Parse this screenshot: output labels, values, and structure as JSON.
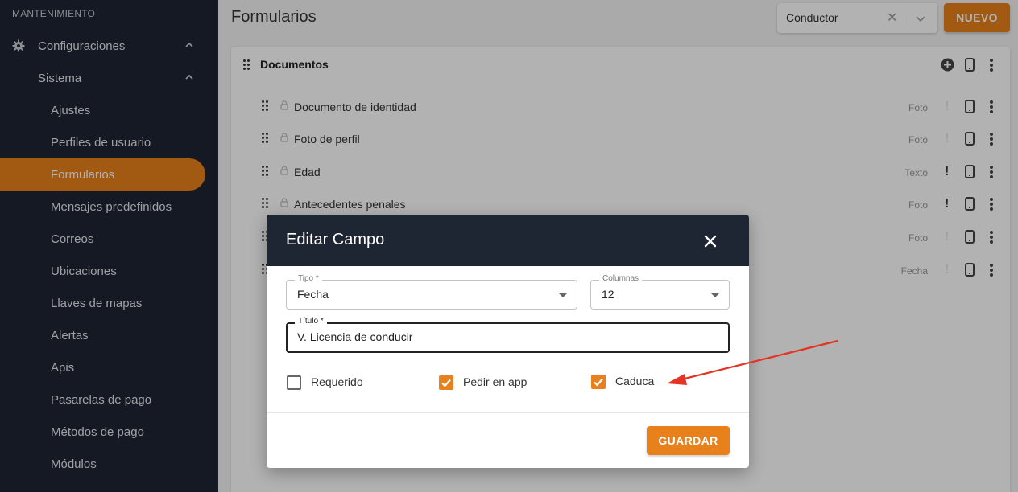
{
  "sidebar": {
    "section_title": "MANTENIMIENTO",
    "items": [
      {
        "label": "Configuraciones",
        "icon": "gear-icon"
      },
      {
        "label": "Sistema"
      },
      {
        "label": "Ajustes"
      },
      {
        "label": "Perfiles de usuario"
      },
      {
        "label": "Formularios",
        "active": true
      },
      {
        "label": "Mensajes predefinidos"
      },
      {
        "label": "Correos"
      },
      {
        "label": "Ubicaciones"
      },
      {
        "label": "Llaves de mapas"
      },
      {
        "label": "Alertas"
      },
      {
        "label": "Apis"
      },
      {
        "label": "Pasarelas de pago"
      },
      {
        "label": "Métodos de pago"
      },
      {
        "label": "Módulos"
      }
    ]
  },
  "header": {
    "title": "Formularios",
    "select_value": "Conductor",
    "new_button": "NUEVO"
  },
  "card": {
    "title": "Documentos",
    "rows": [
      {
        "label": "Documento de identidad",
        "type": "Foto",
        "required": false
      },
      {
        "label": "Foto de perfil",
        "type": "Foto",
        "required": false
      },
      {
        "label": "Edad",
        "type": "Texto",
        "required": true
      },
      {
        "label": "Antecedentes penales",
        "type": "Foto",
        "required": true
      },
      {
        "label": "",
        "type": "Foto",
        "required": false
      },
      {
        "label": "",
        "type": "Fecha",
        "required": false
      }
    ]
  },
  "modal": {
    "title": "Editar Campo",
    "tipo_label": "Tipo *",
    "tipo_value": "Fecha",
    "columnas_label": "Columnas",
    "columnas_value": "12",
    "titulo_label": "Título *",
    "titulo_value": "V. Licencia de conducir",
    "checkboxes": [
      {
        "label": "Requerido",
        "checked": false
      },
      {
        "label": "Pedir en app",
        "checked": true
      },
      {
        "label": "Caduca",
        "checked": true
      }
    ],
    "save_button": "GUARDAR"
  },
  "colors": {
    "accent": "#e8811c",
    "sidebar_bg": "#1e2533",
    "annotation_arrow": "#e53421"
  }
}
